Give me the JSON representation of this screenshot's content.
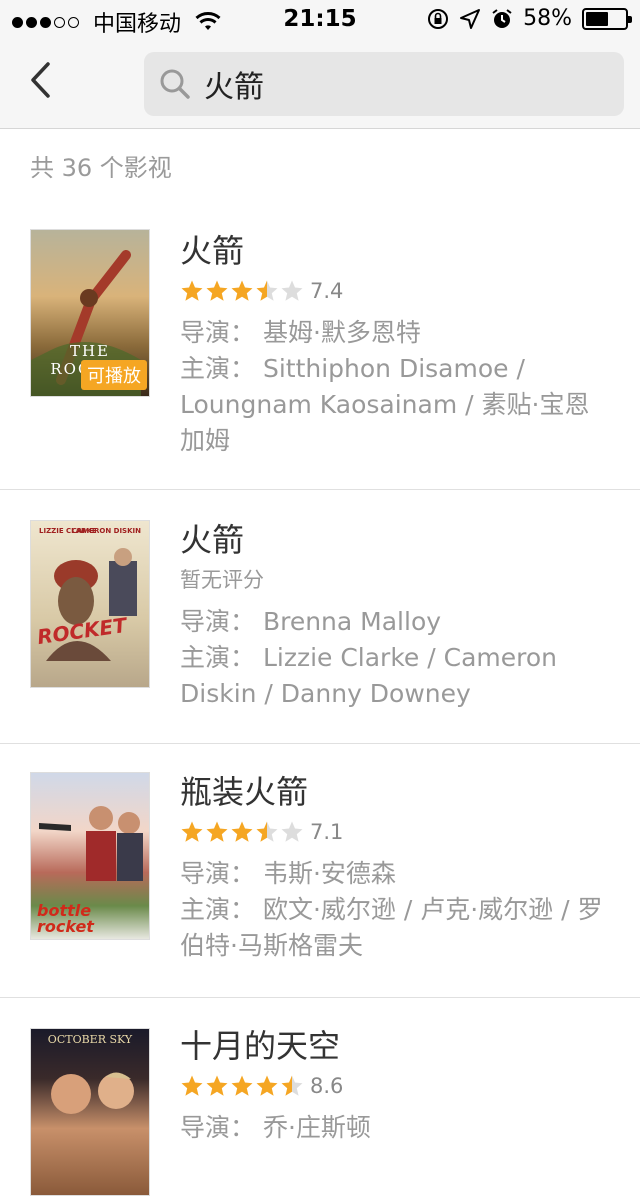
{
  "status_bar": {
    "carrier": "中国移动",
    "time": "21:15",
    "battery_percent": "58%",
    "battery_level": 0.58
  },
  "search": {
    "query": "火箭",
    "placeholder": ""
  },
  "result_count": "共 36 个影视",
  "results": [
    {
      "title": "火箭",
      "rating": "7.4",
      "stars": 3.5,
      "director": "导演：  基姆·默多恩特",
      "cast": "主演：  Sitthiphon Disamoe / Loungnam Kaosainam / 素贴·宝恩加姆",
      "badge": "可播放",
      "poster_text": "THE ROCKET"
    },
    {
      "title": "火箭",
      "rating_text": "暂无评分",
      "director": "导演：  Brenna Malloy",
      "cast": "主演：  Lizzie Clarke / Cameron Diskin / Danny Downey",
      "poster_text": "ROCKET",
      "poster_names": [
        "LIZZIE CLARKE",
        "CAMERON DISKIN"
      ]
    },
    {
      "title": "瓶装火箭",
      "rating": "7.1",
      "stars": 3.5,
      "director": "导演：  韦斯·安德森",
      "cast": "主演：  欧文·威尔逊 / 卢克·威尔逊 / 罗伯特·马斯格雷夫",
      "poster_text": "bottle rocket"
    },
    {
      "title": "十月的天空",
      "rating": "8.6",
      "stars": 4.5,
      "director": "导演：  乔·庄斯顿",
      "poster_text": "OCTOBER SKY"
    }
  ],
  "colors": {
    "star": "#f5a623",
    "star_empty": "#dddddd",
    "meta": "#999999"
  }
}
